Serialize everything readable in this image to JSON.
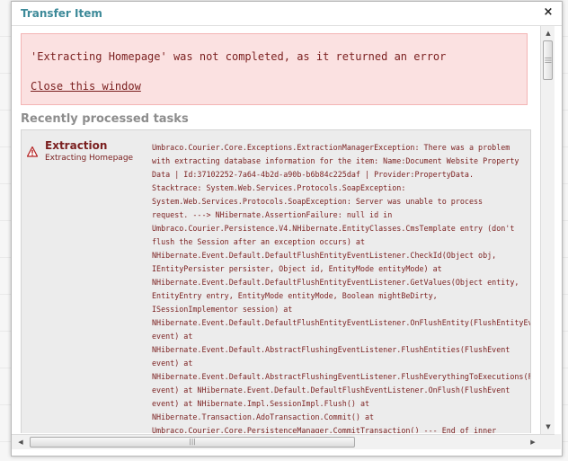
{
  "dialog": {
    "title": "Transfer Item",
    "close_glyph": "×"
  },
  "error": {
    "message": "'Extracting Homepage' was not completed, as it returned an error",
    "close_link": "Close this window"
  },
  "recent": {
    "heading": "Recently processed tasks",
    "tasks": [
      {
        "status_icon": "warning-icon",
        "name": "Extraction",
        "subtitle": "Extracting Homepage",
        "detail": "Umbraco.Courier.Core.Exceptions.ExtractionManagerException: There was a problem\nwith extracting database information for the item: Name:Document Website Property\nData | Id:37102252-7a64-4b2d-a90b-b6b84c225daf | Provider:PropertyData.\nStacktrace: System.Web.Services.Protocols.SoapException:\nSystem.Web.Services.Protocols.SoapException: Server was unable to process\nrequest. ---> NHibernate.AssertionFailure: null id in\nUmbraco.Courier.Persistence.V4.NHibernate.EntityClasses.CmsTemplate entry (don't\nflush the Session after an exception occurs) at\nNHibernate.Event.Default.DefaultFlushEntityEventListener.CheckId(Object obj,\nIEntityPersister persister, Object id, EntityMode entityMode) at\nNHibernate.Event.Default.DefaultFlushEntityEventListener.GetValues(Object entity,\nEntityEntry entry, EntityMode entityMode, Boolean mightBeDirty,\nISessionImplementor session) at\nNHibernate.Event.Default.DefaultFlushEntityEventListener.OnFlushEntity(FlushEntityEvent\nevent) at\nNHibernate.Event.Default.AbstractFlushingEventListener.FlushEntities(FlushEvent\nevent) at\nNHibernate.Event.Default.AbstractFlushingEventListener.FlushEverythingToExecutions(FlushEvent\nevent) at NHibernate.Event.Default.DefaultFlushEventListener.OnFlush(FlushEvent\nevent) at NHibernate.Impl.SessionImpl.Flush() at\nNHibernate.Transaction.AdoTransaction.Commit() at\nUmbraco.Courier.Core.PersistenceManager.CommitTransaction() --- End of inner"
      }
    ]
  },
  "scrollbars": {
    "up_glyph": "▲",
    "down_glyph": "▼",
    "left_glyph": "◀",
    "right_glyph": "▶",
    "grip_glyph": "|||"
  },
  "colors": {
    "title": "#3d8a99",
    "error_text": "#7a1f1f",
    "error_bg": "#fbe1e1",
    "error_border": "#f3b4b4",
    "section_heading": "#8d8d8d",
    "panel_bg": "#ececec"
  }
}
